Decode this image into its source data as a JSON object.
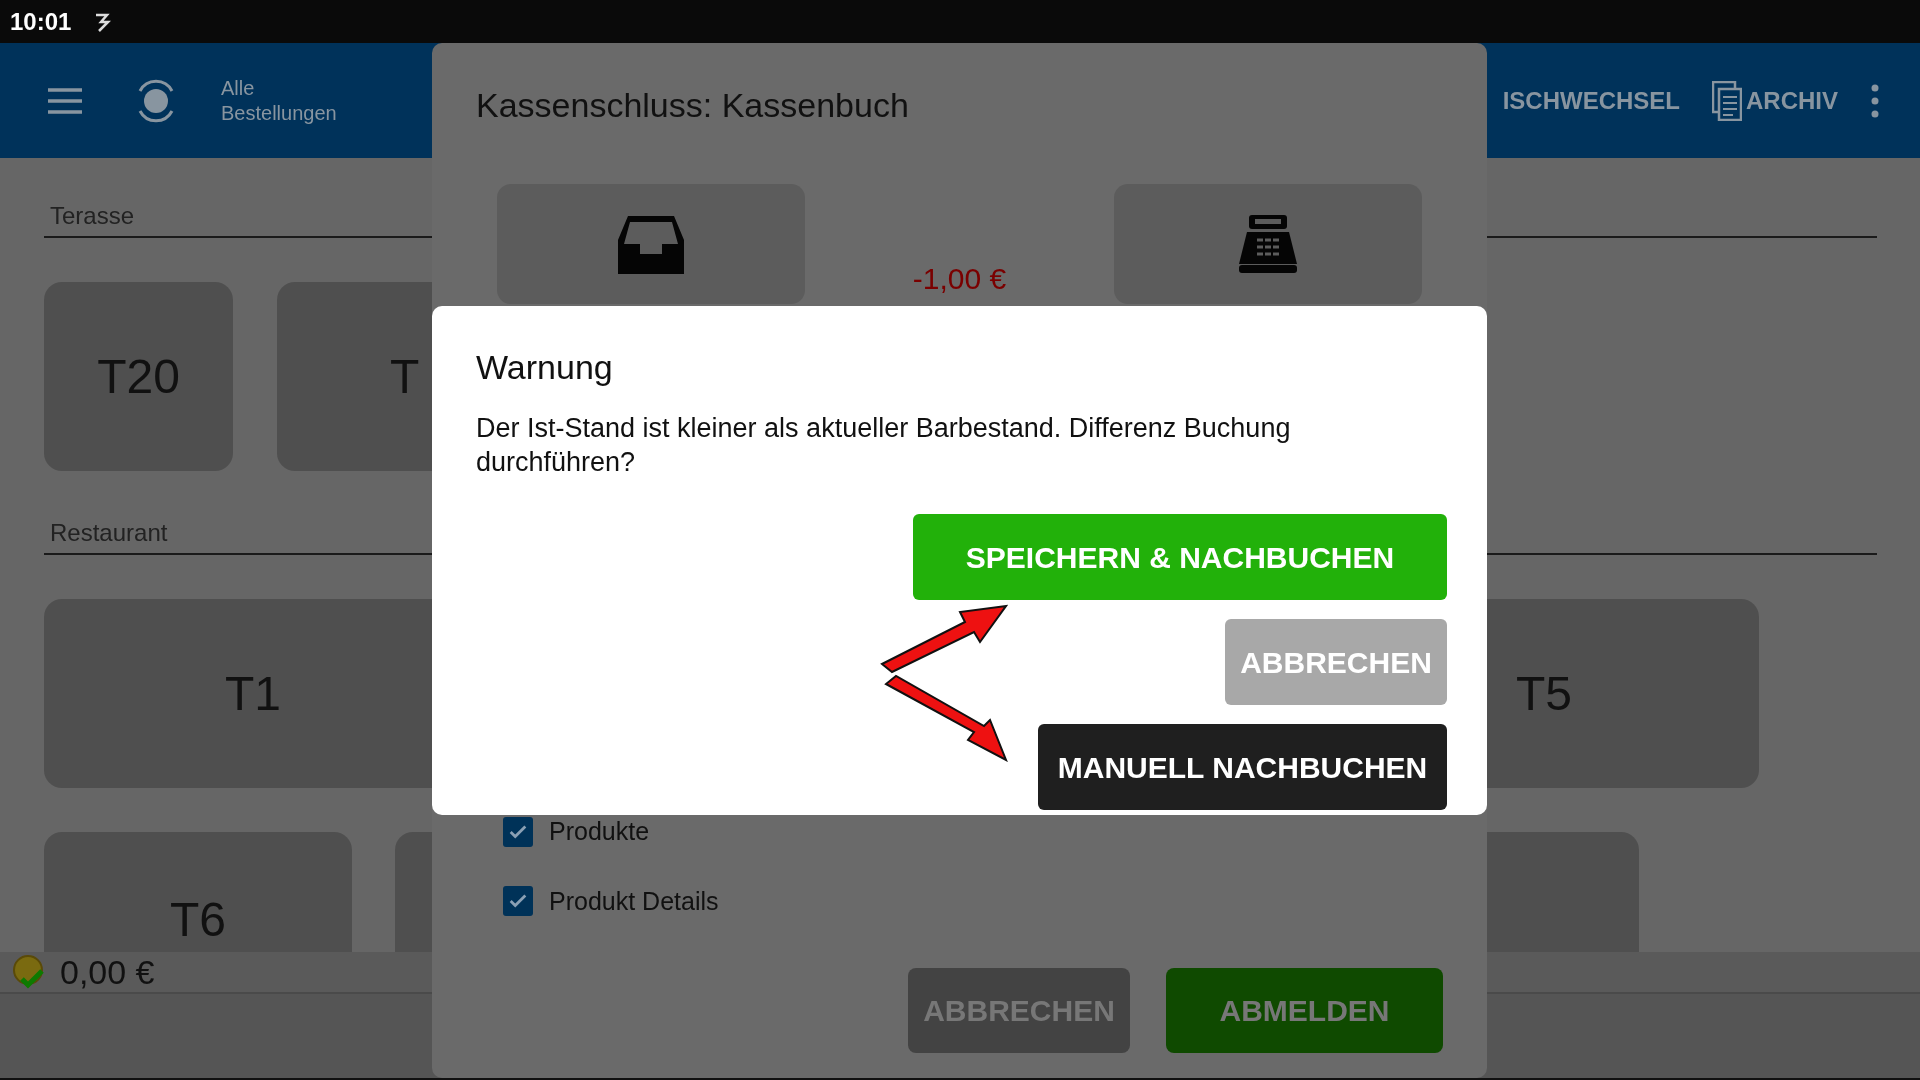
{
  "status_bar": {
    "time": "10:01"
  },
  "app_bar": {
    "title": "Alle Bestellungen",
    "actions": [
      {
        "label": "ISCHWECHSEL",
        "kind": "text"
      },
      {
        "label": "ARCHIV",
        "kind": "archive"
      }
    ]
  },
  "sections": [
    {
      "name": "Terasse",
      "rows": [
        [
          {
            "label": "T20"
          },
          {
            "label": "T"
          }
        ]
      ]
    },
    {
      "name": "Restaurant",
      "rows": [
        [
          {
            "label": "T1"
          },
          {
            "label": "T5"
          }
        ],
        [
          {
            "label": "T6"
          }
        ]
      ]
    }
  ],
  "balance": "0,00 €",
  "cash_dialog": {
    "title": "Kassenschluss: Kassenbuch",
    "difference": "-1,00 €",
    "options": [
      {
        "label": "Produkte",
        "checked": true
      },
      {
        "label": "Produkt Details",
        "checked": true
      }
    ],
    "buttons": [
      {
        "label": "ABBRECHEN",
        "kind": "cancel"
      },
      {
        "label": "ABMELDEN",
        "kind": "primary"
      }
    ]
  },
  "warning_dialog": {
    "title": "Warnung",
    "message": "Der Ist-Stand ist kleiner als aktueller Barbestand. Differenz Buchung durchführen?",
    "buttons": [
      {
        "label": "SPEICHERN & NACHBUCHEN",
        "kind": "save"
      },
      {
        "label": "ABBRECHEN",
        "kind": "cancel"
      },
      {
        "label": "MANUELL NACHBUCHEN",
        "kind": "manual"
      }
    ]
  }
}
